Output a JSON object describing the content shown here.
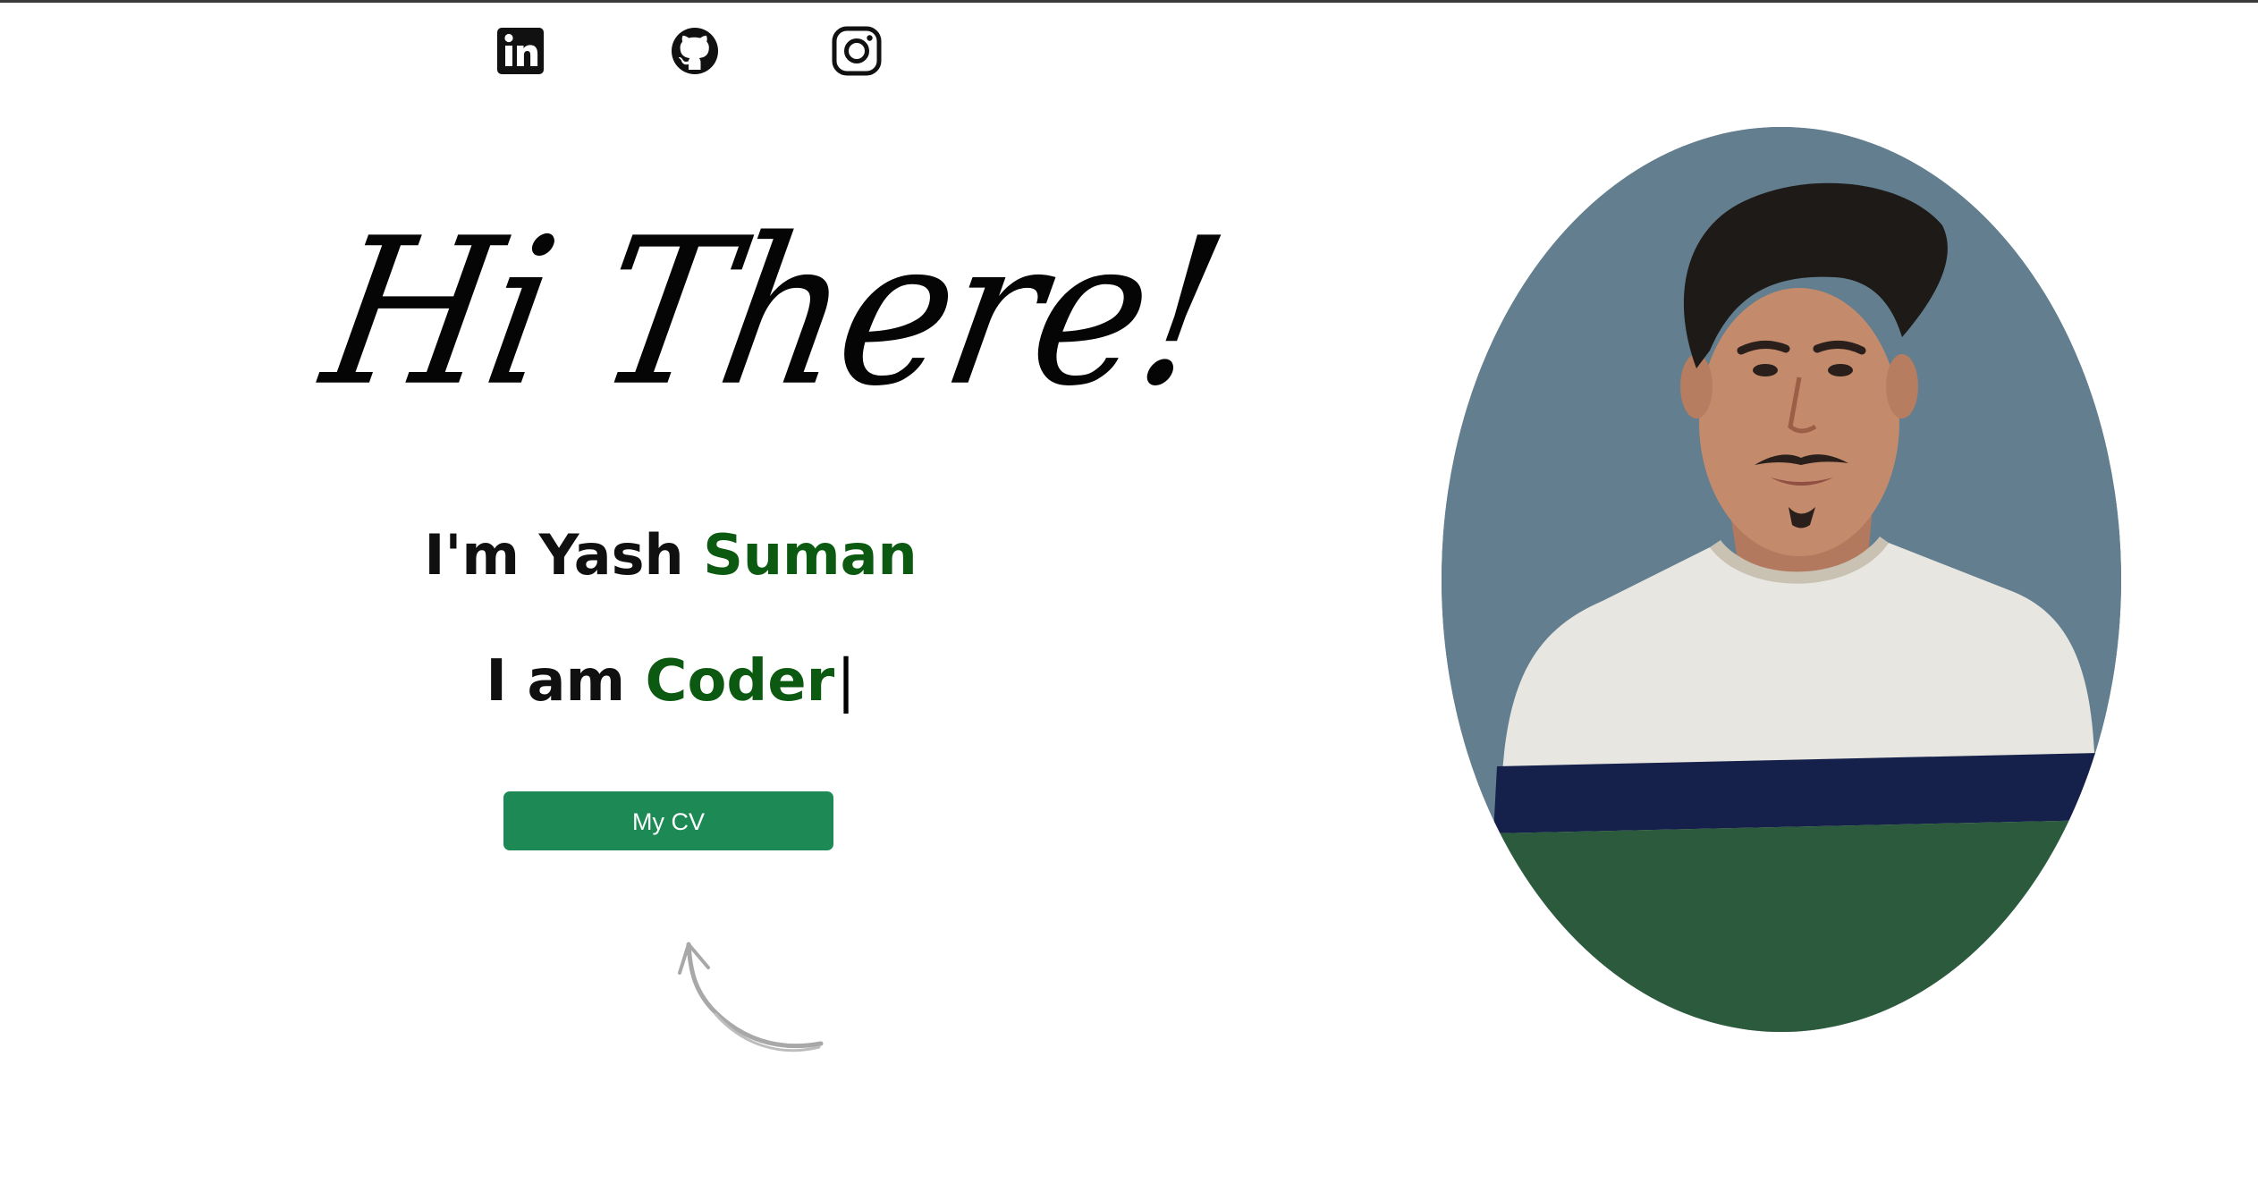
{
  "social": {
    "linkedin": {
      "icon": "linkedin-icon",
      "label": "LinkedIn"
    },
    "github": {
      "icon": "github-icon",
      "label": "GitHub"
    },
    "instagram": {
      "icon": "instagram-icon",
      "label": "Instagram"
    }
  },
  "hero": {
    "greeting": "Hi There!",
    "name_prefix": "I'm Yash ",
    "name_accent": "Suman",
    "role_prefix": "I am ",
    "role_accent": "Coder",
    "cursor": "|",
    "cv_button_label": "My CV"
  },
  "portrait": {
    "icon": "profile-photo",
    "alt": "Profile photo"
  },
  "colors": {
    "accent_text": "#0c5a12",
    "button_bg": "#1d8a55",
    "portrait_bg": "#637e8e"
  }
}
